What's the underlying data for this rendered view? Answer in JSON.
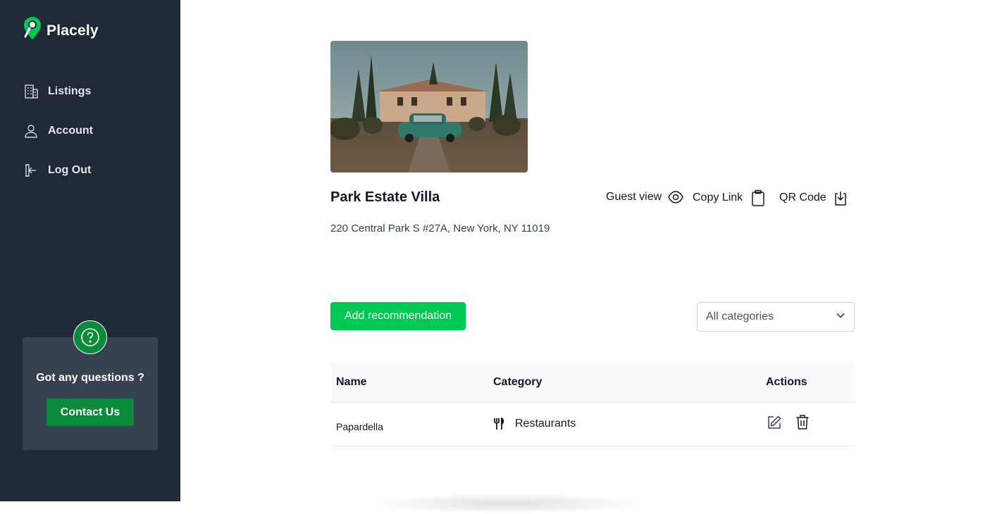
{
  "app": {
    "name": "Placely"
  },
  "sidebar": {
    "items": [
      {
        "label": "Listings",
        "icon": "building-icon"
      },
      {
        "label": "Account",
        "icon": "user-icon"
      },
      {
        "label": "Log Out",
        "icon": "logout-icon"
      }
    ],
    "help": {
      "title": "Got any questions ?",
      "button": "Contact Us"
    }
  },
  "listing": {
    "title": "Park Estate Villa",
    "address": "220 Central Park S #27A, New York, NY 11019",
    "actions": [
      {
        "label": "Guest view",
        "icon": "eye-icon"
      },
      {
        "label": "Copy Link",
        "icon": "clipboard-icon"
      },
      {
        "label": "QR Code",
        "icon": "download-icon"
      }
    ]
  },
  "toolbar": {
    "add_label": "Add recommendation",
    "category_select": "All categories"
  },
  "table": {
    "headers": [
      "Name",
      "Category",
      "Actions"
    ],
    "rows": [
      {
        "name": "Papardella",
        "category": "Restaurants",
        "category_icon": "utensils-icon"
      }
    ]
  },
  "colors": {
    "sidebar_bg": "#1f2937",
    "brand_green": "#00c853",
    "dark_green": "#0a8a3b"
  }
}
